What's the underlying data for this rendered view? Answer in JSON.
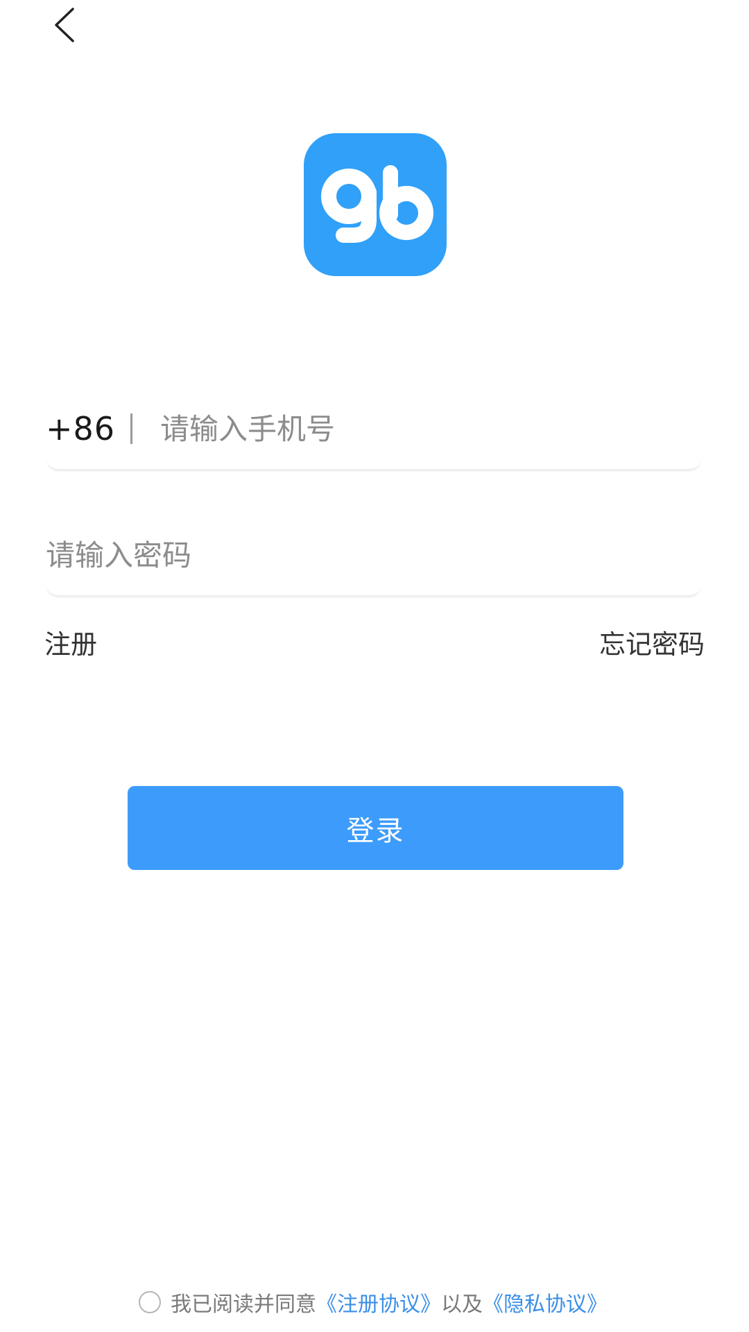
{
  "nav": {
    "back_icon": "chevron-left-icon"
  },
  "app": {
    "logo_icon": "gb-logo",
    "brand_color": "#30a0f8"
  },
  "phone": {
    "country_code": "+86",
    "placeholder": "请输入手机号",
    "value": ""
  },
  "password": {
    "placeholder": "请输入密码",
    "value": ""
  },
  "links": {
    "register": "注册",
    "forgot_password": "忘记密码"
  },
  "login_button": {
    "label": "登录",
    "color": "#3d9cfb"
  },
  "agreement": {
    "checked": false,
    "prefix": "我已阅读并同意",
    "register_terms": "《注册协议》",
    "connector": "以及",
    "privacy_terms": "《隐私协议》",
    "link_color": "#3a8fe8"
  }
}
